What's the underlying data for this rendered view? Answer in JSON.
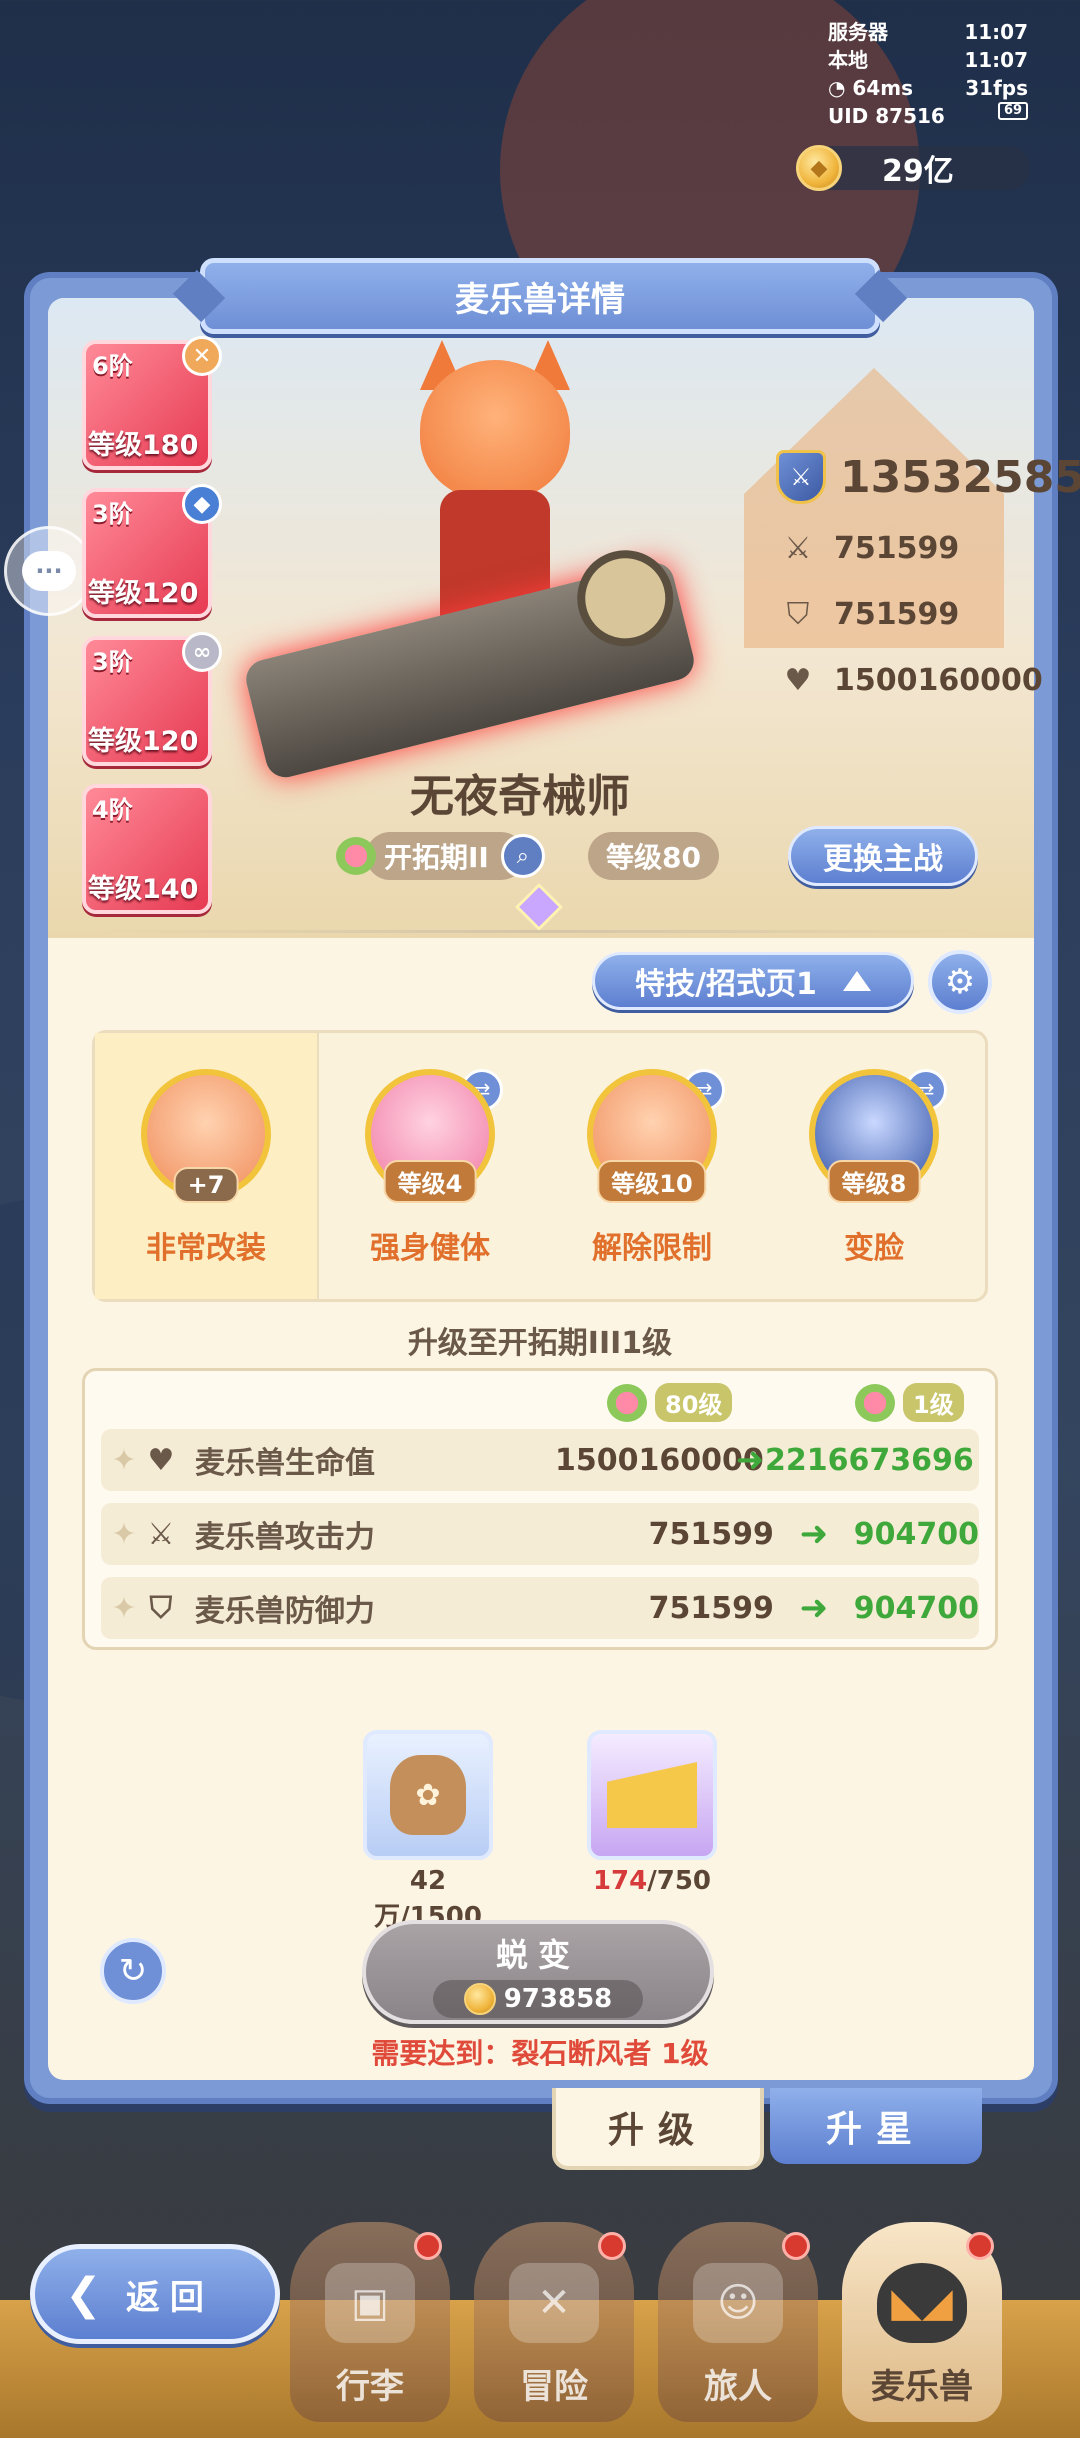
{
  "status": {
    "server_label": "服务器",
    "server_time": "11:07",
    "local_label": "本地",
    "local_time": "11:07",
    "ping": "64ms",
    "fps": "31fps",
    "uid": "UID 87516",
    "battery": "69"
  },
  "currency": {
    "amount": "29亿"
  },
  "panel": {
    "title": "麦乐兽详情"
  },
  "tiles": [
    {
      "stage": "6阶",
      "level": "等级180",
      "badge": "✕",
      "badge_color": "#f0a85a"
    },
    {
      "stage": "3阶",
      "level": "等级120",
      "badge": "◆",
      "badge_color": "#4a7fd6"
    },
    {
      "stage": "3阶",
      "level": "等级120",
      "badge": "∞",
      "badge_color": "#b8b8c8"
    },
    {
      "stage": "4阶",
      "level": "等级140",
      "badge": "",
      "badge_color": ""
    }
  ],
  "character": {
    "name": "无夜奇械师",
    "power": "13532585",
    "attack": "751599",
    "defense": "751599",
    "hp": "1500160000",
    "stage_tag": "开拓期II",
    "level_tag": "等级80",
    "switch_main": "更换主战"
  },
  "skill_page": {
    "label": "特技/招式页1"
  },
  "skills": [
    {
      "name": "非常改装",
      "badge": "+7",
      "style": "orange"
    },
    {
      "name": "强身健体",
      "badge": "等级4",
      "style": "pink"
    },
    {
      "name": "解除限制",
      "badge": "等级10",
      "style": "orange"
    },
    {
      "name": "变脸",
      "badge": "等级8",
      "style": "blue"
    }
  ],
  "upgrade": {
    "title": "升级至开拓期III1级",
    "from_level": "80级",
    "to_level": "1级",
    "rows": [
      {
        "label": "麦乐兽生命值",
        "icon": "heart-icon",
        "old": "1500160000",
        "new": "2216673696"
      },
      {
        "label": "麦乐兽攻击力",
        "icon": "swords-icon",
        "old": "751599",
        "new": "904700"
      },
      {
        "label": "麦乐兽防御力",
        "icon": "shield-icon",
        "old": "751599",
        "new": "904700"
      }
    ]
  },
  "materials": [
    {
      "name": "food-bag",
      "have": "42万",
      "need": "/1500"
    },
    {
      "name": "cheese",
      "have": "174",
      "need": "/750"
    }
  ],
  "evolve": {
    "label": "蜕变",
    "cost": "973858"
  },
  "requirement": "需要达到：裂石断风者  1级",
  "tabs": {
    "upgrade": "升级",
    "star": "升星"
  },
  "nav": {
    "back": "返回",
    "items": [
      "行李",
      "冒险",
      "旅人",
      "麦乐兽"
    ]
  },
  "colors": {
    "accent_blue": "#6f8fd6",
    "panel_cream": "#fdf5e3",
    "increase_green": "#3fa83a",
    "warning_red": "#e04a3a"
  }
}
